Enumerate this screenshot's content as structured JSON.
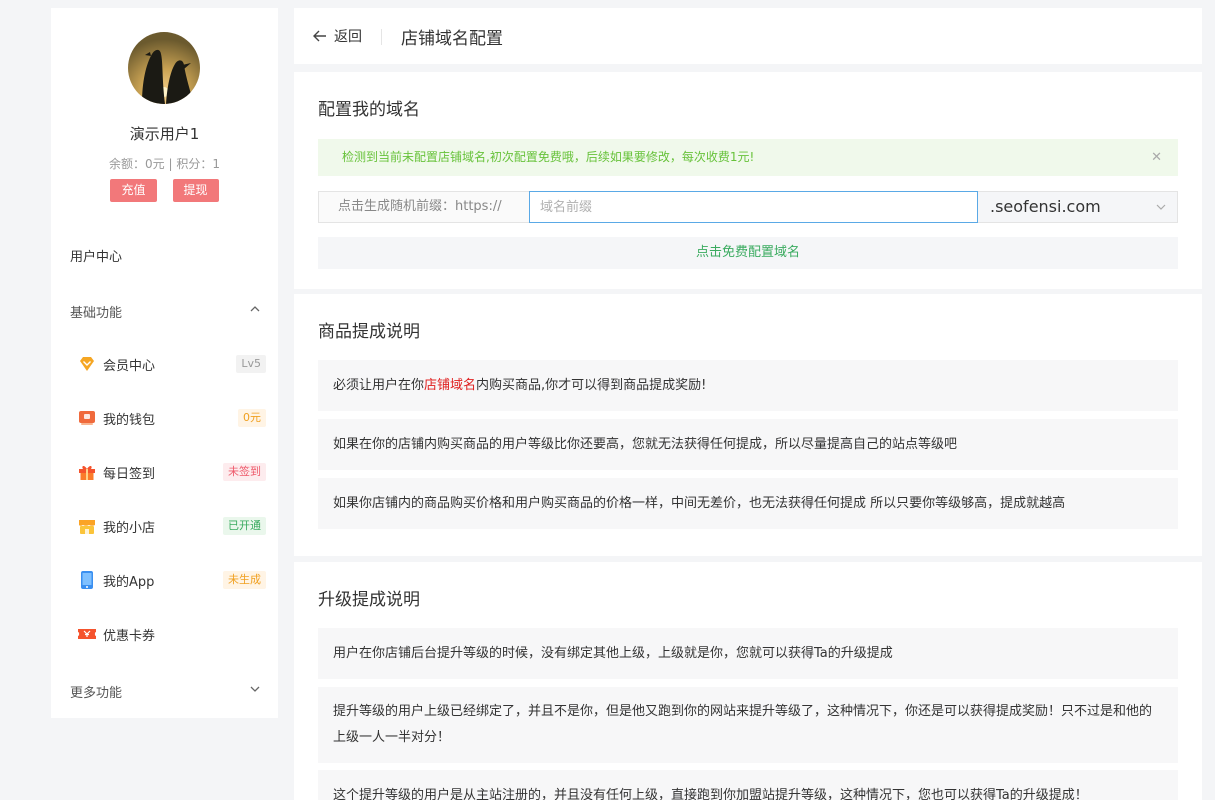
{
  "user": {
    "name": "演示用户1",
    "stats": "余额：0元 | 积分：1",
    "recharge_label": "充值",
    "withdraw_label": "提现"
  },
  "nav": {
    "user_center": "用户中心",
    "basic_section": "基础功能",
    "more_section": "更多功能",
    "items": [
      {
        "label": "会员中心",
        "badge": "Lv5",
        "icon": "diamond-icon"
      },
      {
        "label": "我的钱包",
        "badge": "0元",
        "icon": "wallet-icon"
      },
      {
        "label": "每日签到",
        "badge": "未签到",
        "icon": "gift-icon"
      },
      {
        "label": "我的小店",
        "badge": "已开通",
        "icon": "shop-icon"
      },
      {
        "label": "我的App",
        "badge": "未生成",
        "icon": "phone-icon"
      },
      {
        "label": "优惠卡券",
        "badge": "",
        "icon": "coupon-icon"
      }
    ]
  },
  "header": {
    "back_label": "返回",
    "title": "店铺域名配置"
  },
  "config": {
    "title": "配置我的域名",
    "alert": "检测到当前未配置店铺域名,初次配置免费哦，后续如果要修改，每次收费1元!",
    "prefix_label": "点击生成随机前缀：https://",
    "input_placeholder": "域名前缀",
    "input_value": "",
    "suffix_value": ".seofensi.com",
    "submit_label": "点击免费配置域名"
  },
  "commission": {
    "title": "商品提成说明",
    "item1_before": "必须让用户在你",
    "item1_highlight": "店铺域名",
    "item1_after": "内购买商品,你才可以得到商品提成奖励!",
    "item2": "如果在你的店铺内购买商品的用户等级比你还要高，您就无法获得任何提成，所以尽量提高自己的站点等级吧",
    "item3": "如果你店铺内的商品购买价格和用户购买商品的价格一样，中间无差价，也无法获得任何提成 所以只要你等级够高，提成就越高"
  },
  "upgrade": {
    "title": "升级提成说明",
    "item1": "用户在你店铺后台提升等级的时候，没有绑定其他上级，上级就是你，您就可以获得Ta的升级提成",
    "item2": "提升等级的用户上级已经绑定了，并且不是你，但是他又跑到你的网站来提升等级了，这种情况下，你还是可以获得提成奖励！只不过是和他的上级一人一半对分！",
    "item3": "这个提升等级的用户是从主站注册的，并且没有任何上级，直接跑到你加盟站提升等级，这种情况下，您也可以获得Ta的升级提成！"
  },
  "colors": {
    "accent_red": "#f2787a",
    "success_green": "#67c23a",
    "link_green": "#3aab5f",
    "highlight_red": "#e02020"
  }
}
